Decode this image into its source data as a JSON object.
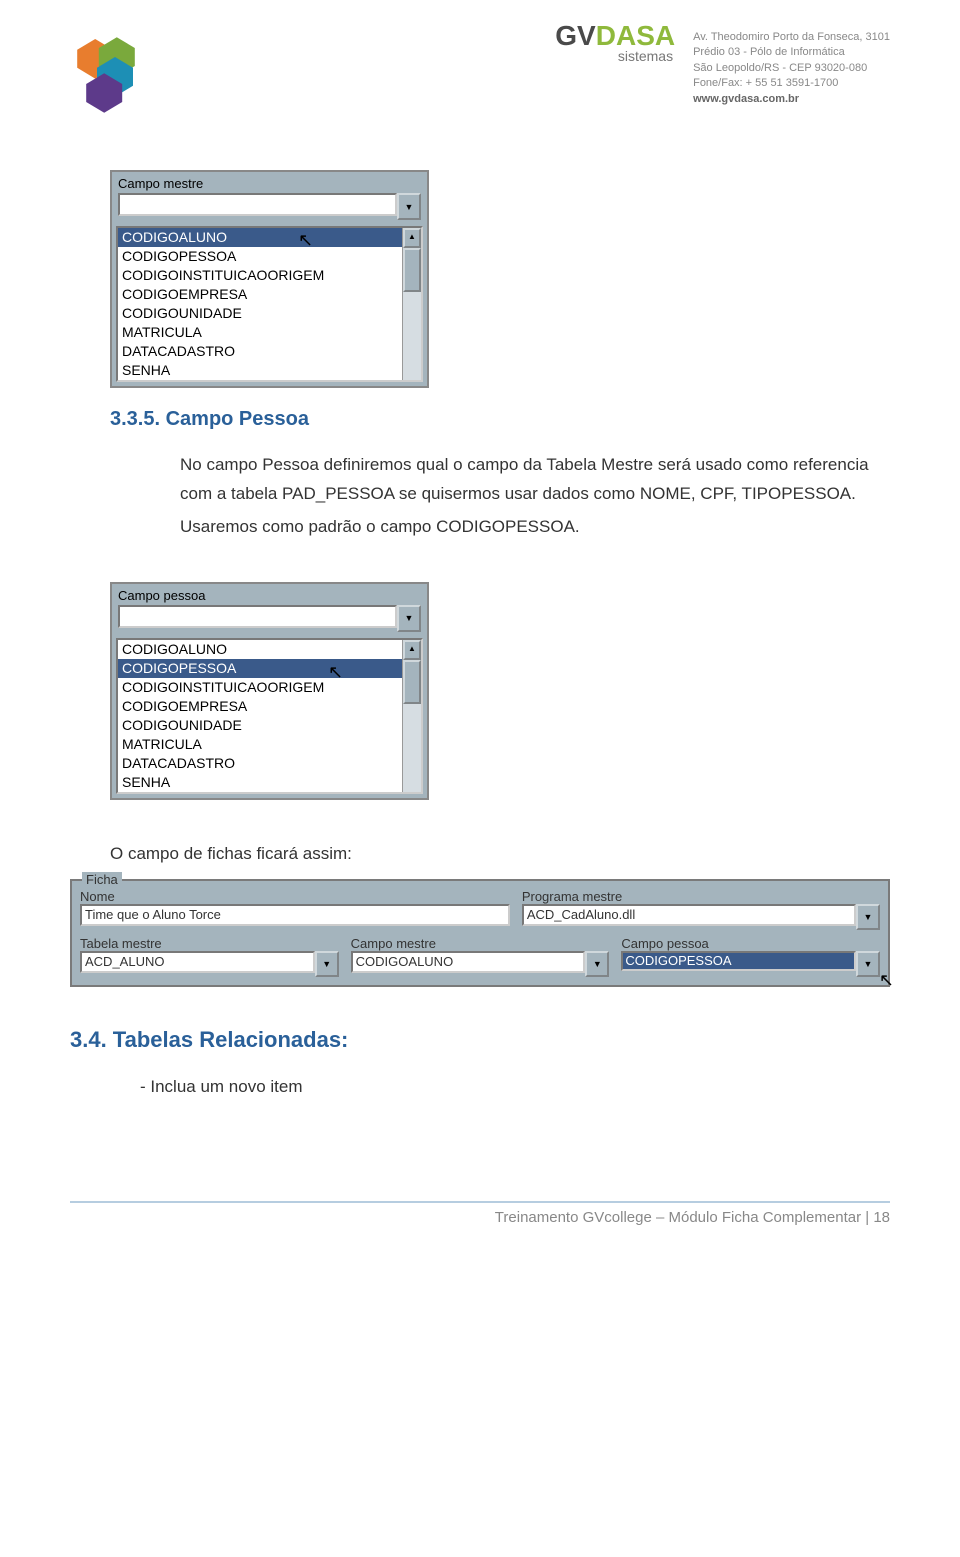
{
  "header": {
    "brand_gv": "GV",
    "brand_dasa": "DASA",
    "brand_sub": "sistemas",
    "address": {
      "line1": "Av. Theodomiro Porto da Fonseca, 3101",
      "line2": "Prédio 03 - Pólo de Informática",
      "line3": "São Leopoldo/RS - CEP 93020-080",
      "line4": "Fone/Fax: + 55 51 3591-1700",
      "line5": "www.gvdasa.com.br"
    }
  },
  "dropdown1": {
    "label": "Campo mestre",
    "items": [
      "CODIGOALUNO",
      "CODIGOPESSOA",
      "CODIGOINSTITUICAOORIGEM",
      "CODIGOEMPRESA",
      "CODIGOUNIDADE",
      "MATRICULA",
      "DATACADASTRO",
      "SENHA"
    ],
    "selected_index": 0
  },
  "section_335": {
    "heading": "3.3.5. Campo Pessoa",
    "p1": "No campo Pessoa definiremos qual o campo da Tabela Mestre será usado como referencia com a tabela PAD_PESSOA se quisermos usar dados como NOME, CPF, TIPOPESSOA.",
    "p2": "Usaremos como padrão o campo CODIGOPESSOA."
  },
  "dropdown2": {
    "label": "Campo pessoa",
    "items": [
      "CODIGOALUNO",
      "CODIGOPESSOA",
      "CODIGOINSTITUICAOORIGEM",
      "CODIGOEMPRESA",
      "CODIGOUNIDADE",
      "MATRICULA",
      "DATACADASTRO",
      "SENHA"
    ],
    "selected_index": 1
  },
  "ficha_intro": "O campo de fichas ficará assim:",
  "ficha": {
    "legend": "Ficha",
    "nome_label": "Nome",
    "nome_value": "Time que o Aluno Torce",
    "prog_label": "Programa mestre",
    "prog_value": "ACD_CadAluno.dll",
    "tabela_label": "Tabela mestre",
    "tabela_value": "ACD_ALUNO",
    "campo_mestre_label": "Campo mestre",
    "campo_mestre_value": "CODIGOALUNO",
    "campo_pessoa_label": "Campo pessoa",
    "campo_pessoa_value": "CODIGOPESSOA"
  },
  "section_34": {
    "heading": "3.4. Tabelas Relacionadas:",
    "bullet": "- Inclua um novo item"
  },
  "footer": {
    "text": "Treinamento GVcollege – Módulo Ficha Complementar | 18"
  }
}
